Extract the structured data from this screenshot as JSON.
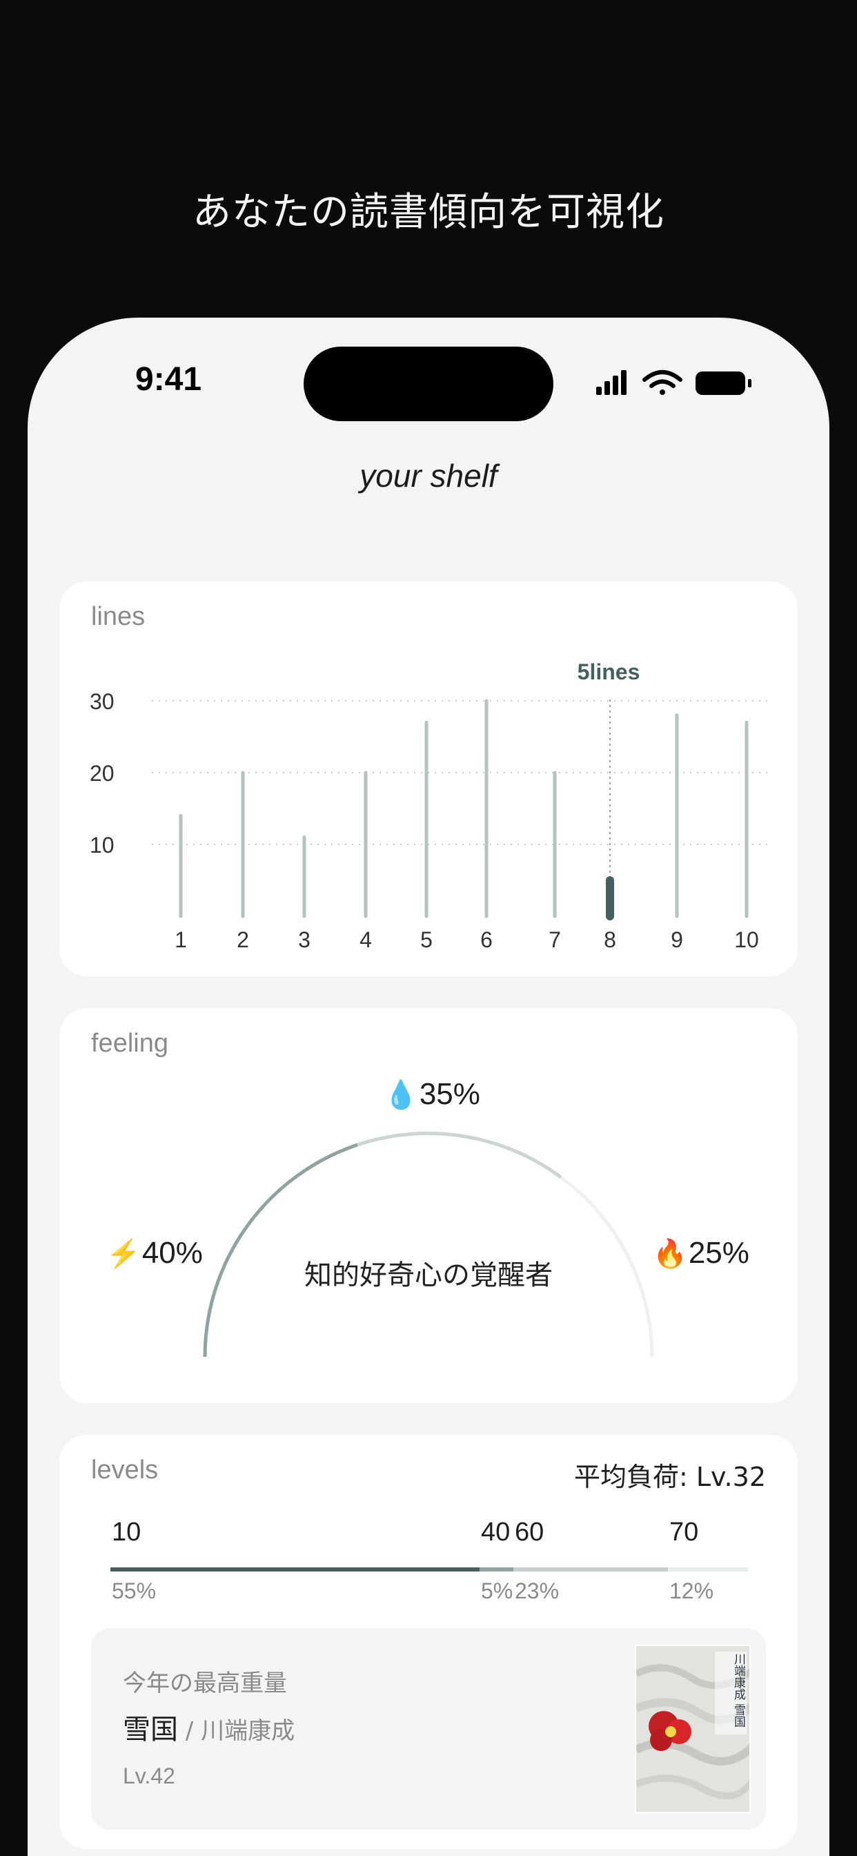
{
  "headline": "あなたの読書傾向を可視化",
  "status_bar": {
    "time": "9:41"
  },
  "shelf_title": "your shelf",
  "lines_card": {
    "label": "lines",
    "selected_label": "5lines"
  },
  "chart_data": {
    "type": "bar",
    "categories": [
      "1",
      "2",
      "3",
      "4",
      "5",
      "6",
      "7",
      "8",
      "9",
      "10"
    ],
    "values": [
      14,
      20,
      11,
      20,
      27,
      30,
      20,
      5,
      28,
      27
    ],
    "yticks": [
      10,
      20,
      30
    ],
    "ylim": [
      0,
      30
    ],
    "highlighted_index": 7,
    "colors": {
      "bar": "#b5c2bf",
      "highlight": "#45615f",
      "grid": "#c9cfcd"
    }
  },
  "feeling_card": {
    "label": "feeling",
    "top": {
      "icon": "droplet-icon",
      "emoji": "💧",
      "value": "35%"
    },
    "left": {
      "icon": "lightning-icon",
      "emoji": "⚡",
      "value": "40%"
    },
    "right": {
      "icon": "fire-icon",
      "emoji": "🔥",
      "value": "25%"
    },
    "type_name": "知的好奇心の覚醒者"
  },
  "levels_card": {
    "label": "levels",
    "avg_load": "平均負荷: Lv.32",
    "segments": [
      {
        "level": "10",
        "pct": "55%",
        "fraction": 0.55,
        "color": "#45615f"
      },
      {
        "level": "40",
        "pct": "5%",
        "fraction": 0.05,
        "color": "#8fa3a0"
      },
      {
        "level": "60",
        "pct": "23%",
        "fraction": 0.23,
        "color": "#c7d0ce"
      },
      {
        "level": "70",
        "pct": "12%",
        "fraction": 0.12,
        "color": "#e8ecea"
      }
    ],
    "best": {
      "label": "今年の最高重量",
      "title": "雪国",
      "author": " / 川端康成",
      "level": "Lv.42",
      "cover_text": "川端康成 雪国"
    }
  }
}
